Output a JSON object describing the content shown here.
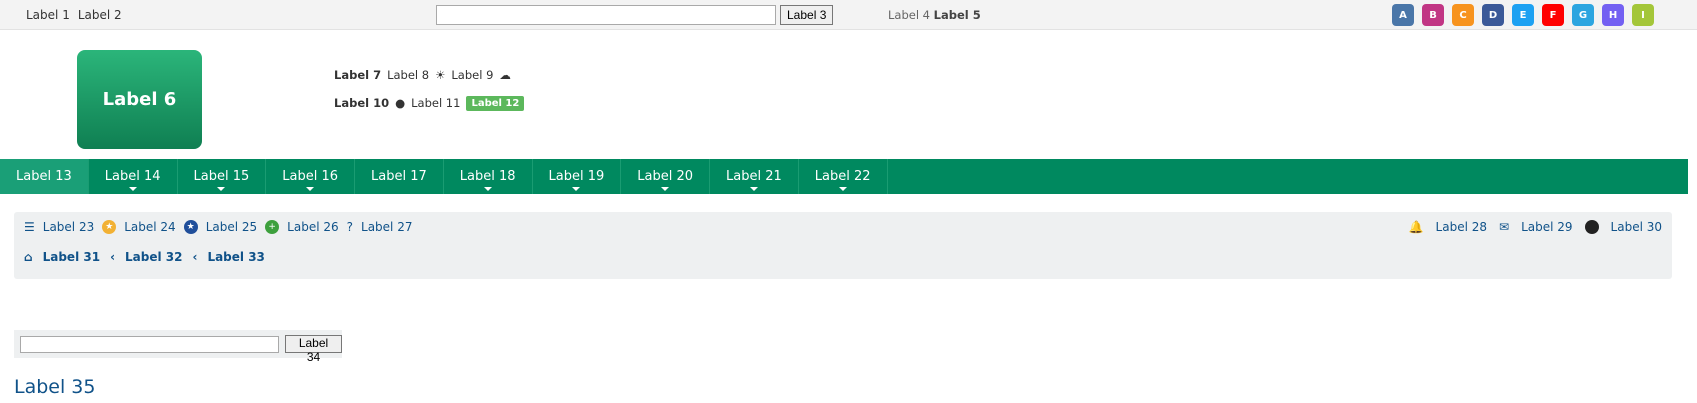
{
  "topbar": {
    "left_label": "Label 1",
    "garage_label": "Label 2",
    "search_button": "Label 3",
    "date_text": "Label 4",
    "time_text": "Label 5",
    "social_labels": [
      "A",
      "B",
      "C",
      "D",
      "E",
      "F",
      "G",
      "H",
      "I"
    ]
  },
  "header": {
    "logo_text": "Label 6",
    "weather_label": "Label 7",
    "today_text": "Label 8",
    "tomorrow_text": "Label 9",
    "traffic_label": "Label 10",
    "traffic_score": "Label 11",
    "traffic_badge": "Label 12"
  },
  "nav": {
    "items": [
      "Label 13",
      "Label 14",
      "Label 15",
      "Label 16",
      "Label 17",
      "Label 18",
      "Label 19",
      "Label 20",
      "Label 21",
      "Label 22"
    ]
  },
  "panel": {
    "links": [
      "Label 23",
      "Label 24",
      "Label 25",
      "Label 26",
      "Label 27"
    ],
    "right": [
      "Label 28",
      "Label 29",
      "Label 30"
    ],
    "breadcrumb": [
      "Label 31",
      "Label 32",
      "Label 33"
    ]
  },
  "search2": {
    "button": "Label 34"
  },
  "main": {
    "title": "Label 35"
  }
}
